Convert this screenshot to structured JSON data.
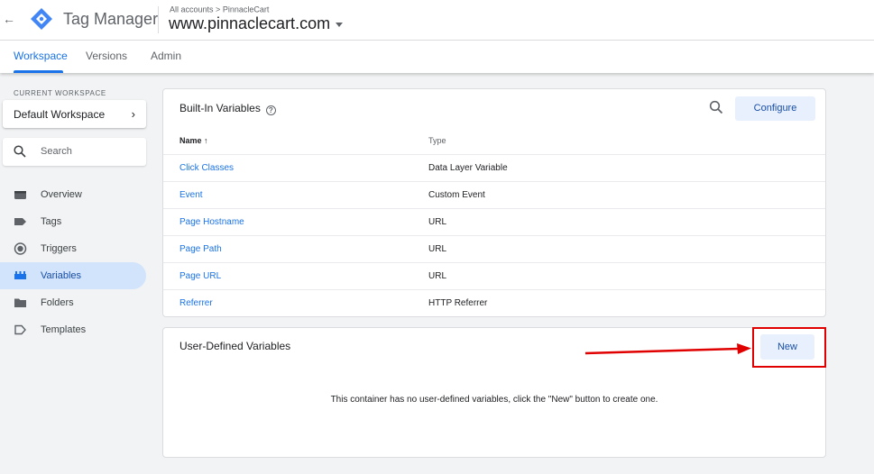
{
  "header": {
    "app_title": "Tag Manager",
    "breadcrumb": {
      "root": "All accounts",
      "separator": ">",
      "account": "PinnacleCart"
    },
    "container": "www.pinnaclecart.com"
  },
  "tabs": [
    {
      "label": "Workspace",
      "active": true
    },
    {
      "label": "Versions",
      "active": false
    },
    {
      "label": "Admin",
      "active": false
    }
  ],
  "sidebar": {
    "current_workspace_label": "CURRENT WORKSPACE",
    "workspace_name": "Default Workspace",
    "search_placeholder": "Search",
    "items": [
      {
        "label": "Overview",
        "icon": "overview-icon"
      },
      {
        "label": "Tags",
        "icon": "tag-icon"
      },
      {
        "label": "Triggers",
        "icon": "trigger-icon"
      },
      {
        "label": "Variables",
        "icon": "variables-icon",
        "active": true
      },
      {
        "label": "Folders",
        "icon": "folder-icon"
      },
      {
        "label": "Templates",
        "icon": "template-icon"
      }
    ]
  },
  "builtin": {
    "title": "Built-In Variables",
    "configure_label": "Configure",
    "col_name": "Name",
    "col_type": "Type",
    "rows": [
      {
        "name": "Click Classes",
        "type": "Data Layer Variable"
      },
      {
        "name": "Event",
        "type": "Custom Event"
      },
      {
        "name": "Page Hostname",
        "type": "URL"
      },
      {
        "name": "Page Path",
        "type": "URL"
      },
      {
        "name": "Page URL",
        "type": "URL"
      },
      {
        "name": "Referrer",
        "type": "HTTP Referrer"
      }
    ]
  },
  "user_defined": {
    "title": "User-Defined Variables",
    "new_label": "New",
    "empty_message": "This container has no user-defined variables, click the \"New\" button to create one."
  },
  "colors": {
    "accent": "#1a73e8",
    "active_nav_bg": "#d2e3fc",
    "annotation": "#e10000"
  }
}
